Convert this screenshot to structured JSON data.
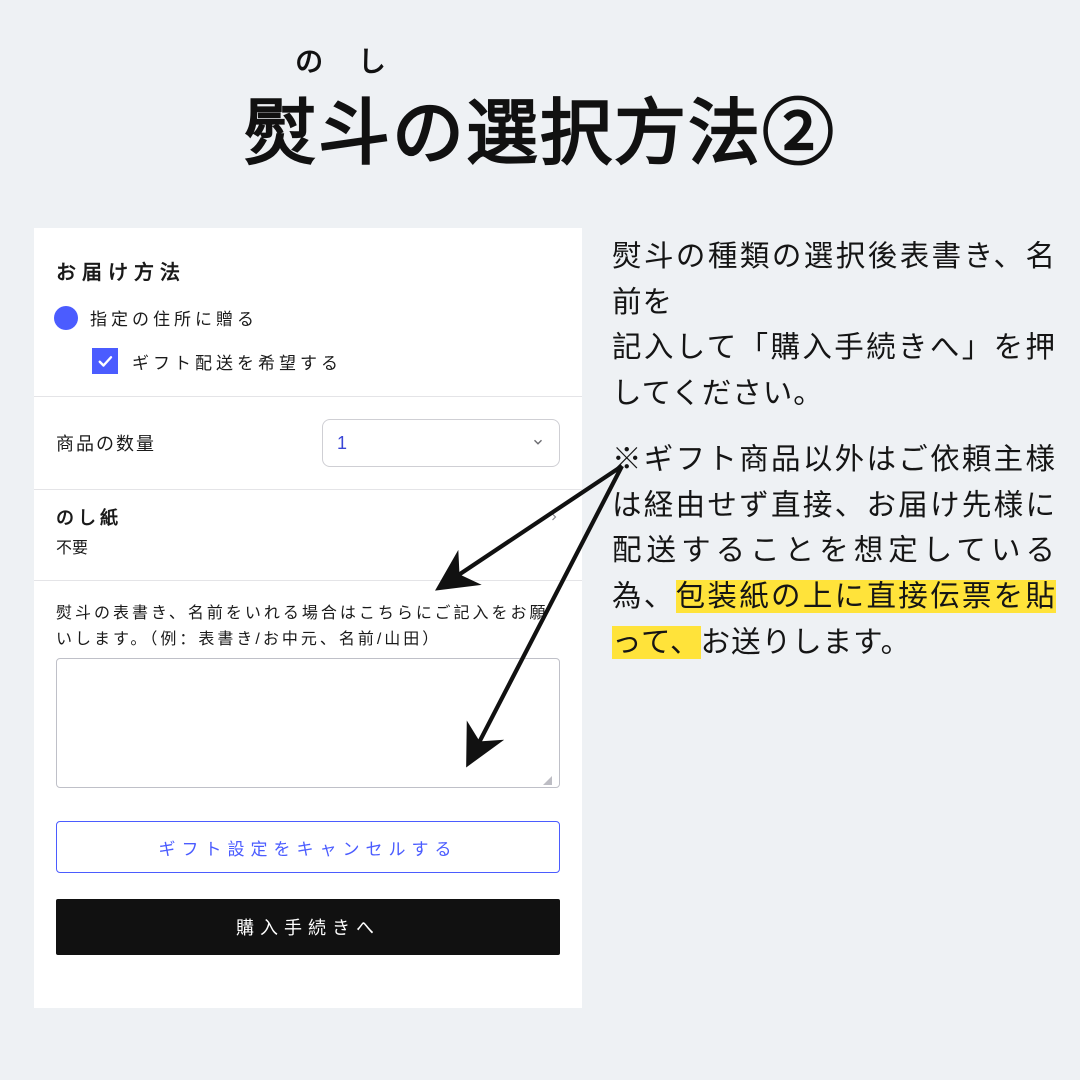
{
  "title": {
    "ruby_no": "の",
    "ruby_shi": "し",
    "main": "熨斗の選択方法②"
  },
  "form": {
    "delivery_heading": "お届け方法",
    "radio_label": "指定の住所に贈る",
    "gift_checkbox_label": "ギフト配送を希望する",
    "quantity_label": "商品の数量",
    "quantity_value": "1",
    "noshi_label": "のし紙",
    "noshi_value": "不要",
    "noshi_textarea_help": "熨斗の表書き、名前をいれる場合はこちらにご記入をお願いします。（例：表書き/お中元、名前/山田）",
    "noshi_textarea_value": "",
    "cancel_button": "ギフト設定をキャンセルする",
    "proceed_button": "購入手続きへ"
  },
  "explain": {
    "para1": "熨斗の種類の選択後表書き、名前を",
    "para1b": "記入して「購入手続きへ」を押してください。",
    "para2_pre": "※ギフト商品以外はご依頼主様は経由せず直接、お届け先様に配送することを想定している為、",
    "para2_hl": "包装紙の上に直接伝票を貼って、",
    "para2_post": "お送りします。"
  }
}
